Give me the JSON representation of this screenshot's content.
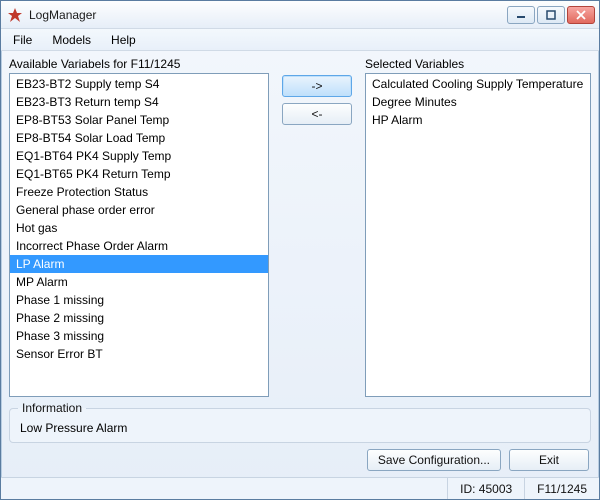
{
  "window": {
    "title": "LogManager"
  },
  "menu": {
    "file": "File",
    "models": "Models",
    "help": "Help"
  },
  "labels": {
    "available": "Available Variabels for F11/1245",
    "selected": "Selected Variables",
    "information_legend": "Information"
  },
  "available": {
    "items": [
      "EB23-BT2 Supply temp S4",
      "EB23-BT3 Return temp S4",
      "EP8-BT53 Solar Panel Temp",
      "EP8-BT54 Solar Load Temp",
      "EQ1-BT64 PK4 Supply Temp",
      "EQ1-BT65 PK4 Return Temp",
      "Freeze Protection Status",
      "General phase order error",
      "Hot gas",
      "Incorrect Phase Order Alarm",
      "LP Alarm",
      "MP Alarm",
      "Phase 1 missing",
      "Phase 2 missing",
      "Phase 3 missing",
      "Sensor Error BT"
    ],
    "selected_index": 10
  },
  "selected": {
    "items": [
      "Calculated Cooling Supply Temperature",
      "Degree Minutes",
      "HP Alarm"
    ]
  },
  "transfer": {
    "add": "->",
    "remove": "<-"
  },
  "information": {
    "text": "Low Pressure Alarm"
  },
  "buttons": {
    "save": "Save Configuration...",
    "exit": "Exit"
  },
  "status": {
    "id_label": "ID: 45003",
    "model": "F11/1245"
  }
}
